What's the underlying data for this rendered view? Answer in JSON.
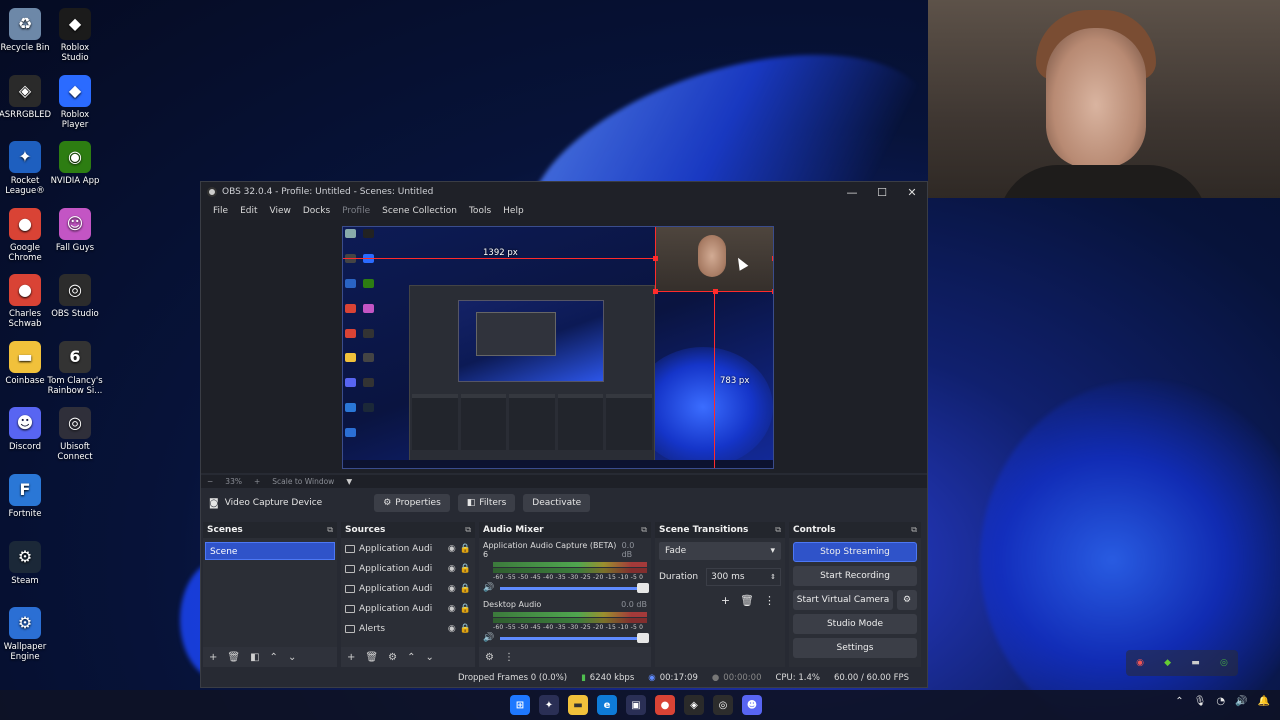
{
  "desktop_icons": [
    {
      "label": "Recycle Bin",
      "icon": "recycle-bin-icon",
      "color": "#6d88a8",
      "glyph": "♻"
    },
    {
      "label": "Roblox Studio",
      "icon": "roblox-studio-icon",
      "color": "#1b1b1b",
      "glyph": "◆"
    },
    {
      "label": "ASRRGBLED",
      "icon": "asrrgbled-icon",
      "color": "#2a2a2a",
      "glyph": "◈"
    },
    {
      "label": "Roblox Player",
      "icon": "roblox-player-icon",
      "color": "#2b6bff",
      "glyph": "◆"
    },
    {
      "label": "Rocket League®",
      "icon": "rocket-league-icon",
      "color": "#1e5fbf",
      "glyph": "✦"
    },
    {
      "label": "NVIDIA App",
      "icon": "nvidia-icon",
      "color": "#2d7d12",
      "glyph": "◉"
    },
    {
      "label": "Google Chrome",
      "icon": "chrome-icon",
      "color": "#d94335",
      "glyph": "●"
    },
    {
      "label": "Fall Guys",
      "icon": "fall-guys-icon",
      "color": "#c355c4",
      "glyph": "☺"
    },
    {
      "label": "Charles Schwab",
      "icon": "chrome-icon",
      "color": "#d94335",
      "glyph": "●"
    },
    {
      "label": "OBS Studio",
      "icon": "obs-studio-icon",
      "color": "#2c2c2c",
      "glyph": "◎"
    },
    {
      "label": "Coinbase",
      "icon": "folder-icon",
      "color": "#f1c13b",
      "glyph": "▬"
    },
    {
      "label": "Tom Clancy's Rainbow Si...",
      "icon": "rainbow-six-icon",
      "color": "#333333",
      "glyph": "6"
    },
    {
      "label": "Discord",
      "icon": "discord-icon",
      "color": "#5865f2",
      "glyph": "☻"
    },
    {
      "label": "Ubisoft Connect",
      "icon": "ubisoft-icon",
      "color": "#2f2f3a",
      "glyph": "◎"
    },
    {
      "label": "Fortnite",
      "icon": "fortnite-icon",
      "color": "#2a77d6",
      "glyph": "F"
    },
    {
      "label": "Steam",
      "icon": "steam-icon",
      "color": "#1b2838",
      "glyph": "⚙"
    },
    {
      "label": "Wallpaper Engine",
      "icon": "wallpaper-engine-icon",
      "color": "#2b6fd4",
      "glyph": "⚙"
    }
  ],
  "obs": {
    "title": "OBS 32.0.4 - Profile: Untitled - Scenes: Untitled",
    "window_buttons": {
      "minimize": "—",
      "maximize": "☐",
      "close": "✕"
    },
    "menu": [
      "File",
      "Edit",
      "View",
      "Docks",
      "Profile",
      "Scene Collection",
      "Tools",
      "Help"
    ],
    "preview": {
      "width_label": "1392 px",
      "height_label": "783 px"
    },
    "zoom": {
      "minus": "−",
      "value": "33%",
      "plus": "+",
      "scale_label": "Scale to Window",
      "dropdown": "▼"
    },
    "source_bar": {
      "source_name": "Video Capture Device",
      "properties": "Properties",
      "filters": "Filters",
      "deactivate": "Deactivate"
    },
    "scenes": {
      "title": "Scenes",
      "items": [
        "Scene"
      ]
    },
    "sources": {
      "title": "Sources",
      "items": [
        "Application Audi",
        "Application Audi",
        "Application Audi",
        "Application Audi",
        "Alerts"
      ]
    },
    "mixer": {
      "title": "Audio Mixer",
      "channels": [
        {
          "name": "Application Audio Capture (BETA) 6",
          "db": "0.0 dB"
        },
        {
          "name": "Desktop Audio",
          "db": "0.0 dB"
        }
      ],
      "ticks": "-60 -55 -50 -45 -40 -35 -30 -25 -20 -15 -10 -5 0"
    },
    "transitions": {
      "title": "Scene Transitions",
      "selected": "Fade",
      "duration_label": "Duration",
      "duration_value": "300 ms"
    },
    "controls": {
      "title": "Controls",
      "stop_streaming": "Stop Streaming",
      "start_recording": "Start Recording",
      "start_virtual_camera": "Start Virtual Camera",
      "studio_mode": "Studio Mode",
      "settings": "Settings"
    },
    "status": {
      "dropped_frames": "Dropped Frames 0 (0.0%)",
      "bitrate": "6240 kbps",
      "stream_time": "00:17:09",
      "rec_time": "00:00:00",
      "cpu": "CPU: 1.4%",
      "fps": "60.00 / 60.00 FPS"
    }
  },
  "colors": {
    "accent": "#2f53c9",
    "selection_red": "#ff2b2b",
    "window_bg": "#272a33"
  }
}
